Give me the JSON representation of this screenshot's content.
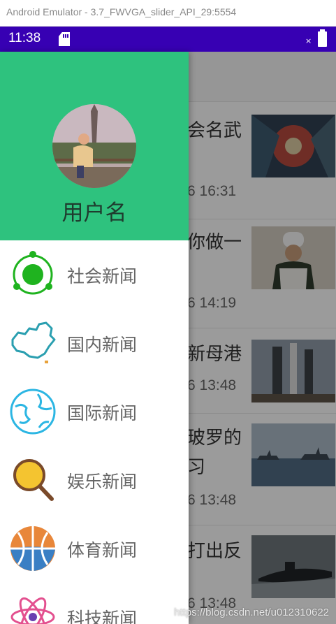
{
  "window": {
    "title": "Android Emulator - 3.7_FWVGA_slider_API_29:5554"
  },
  "statusbar": {
    "time": "11:38",
    "signal_mark": "×",
    "icons": [
      "sd-card-icon",
      "battery-icon"
    ]
  },
  "news": [
    {
      "title": "会名武",
      "time": "6 16:31",
      "thumb": "huddle-photo"
    },
    {
      "title": "你做一",
      "time": "6 14:19",
      "thumb": "chef-photo"
    },
    {
      "title": "新母港",
      "time": "6 13:48",
      "thumb": "launch-pad-photo"
    },
    {
      "title": "玻罗的",
      "title2": "习",
      "time": "6 13:48",
      "thumb": "warships-photo"
    },
    {
      "title": "打出反",
      "time": "6 13:48",
      "thumb": "submarine-photo"
    }
  ],
  "drawer": {
    "header_color": "#2ec27e",
    "username": "用户名",
    "items": [
      {
        "label": "社会新闻",
        "icon": "society-icon"
      },
      {
        "label": "国内新闻",
        "icon": "china-map-icon"
      },
      {
        "label": "国际新闻",
        "icon": "globe-icon"
      },
      {
        "label": "娱乐新闻",
        "icon": "magnifier-icon"
      },
      {
        "label": "体育新闻",
        "icon": "basketball-icon"
      },
      {
        "label": "科技新闻",
        "icon": "atom-icon"
      }
    ]
  },
  "watermark": "https://blog.csdn.net/u012310622"
}
